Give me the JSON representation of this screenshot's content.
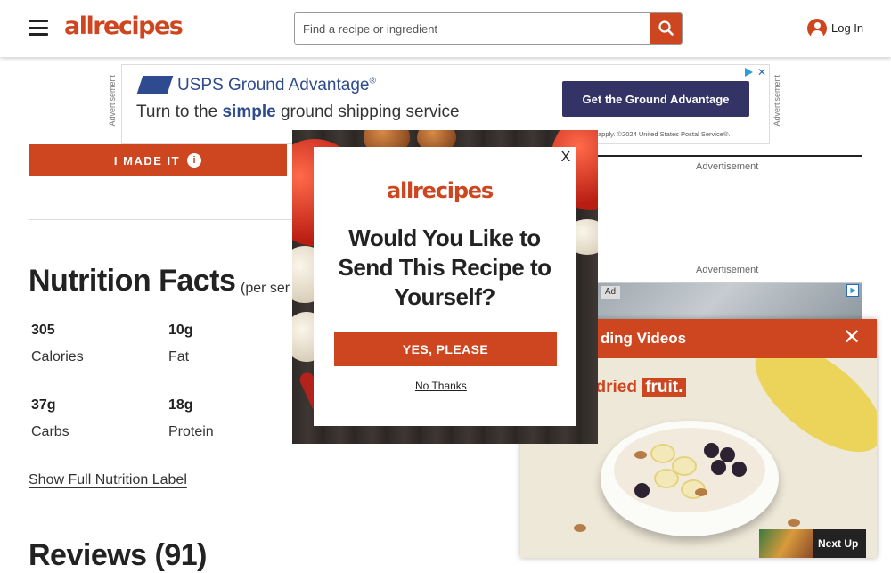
{
  "header": {
    "logo_text": "allrecipes",
    "search_placeholder": "Find a recipe or ingredient",
    "login_label": "Log In"
  },
  "top_ad": {
    "side_label": "Advertisement",
    "brand": "USPS Ground Advantage",
    "brand_mark": "®",
    "headline_pre": "Turn to the ",
    "headline_bold": "simple",
    "headline_post": " ground shipping service",
    "cta": "Get the Ground Advantage",
    "fine_print": "apply. ©2024 United States Postal Service®."
  },
  "recipe": {
    "made_it_label": "I MADE IT",
    "nutrition_title": "Nutrition Facts",
    "nutrition_subtitle": "(per ser",
    "nutrients": [
      {
        "value": "305",
        "label": "Calories"
      },
      {
        "value": "10g",
        "label": "Fat"
      },
      {
        "value": "37g",
        "label": "Carbs"
      },
      {
        "value": "18g",
        "label": "Protein"
      }
    ],
    "full_label_link": "Show Full Nutrition Label",
    "reviews_title": "Reviews (91)"
  },
  "right_rail": {
    "ad_label_1": "Advertisement",
    "ad_label_2": "Advertisement",
    "ad_tag": "Ad"
  },
  "video_player": {
    "title": "ding Videos",
    "caption_pre": "resh and dried ",
    "caption_highlight": "fruit.",
    "next_up_label": "Next Up"
  },
  "modal": {
    "close_label": "X",
    "logo_text": "allrecipes",
    "question": "Would You Like to Send This Recipe to Yourself?",
    "yes_label": "YES, PLEASE",
    "no_label": "No Thanks"
  },
  "colors": {
    "brand": "#ce4620",
    "usps_blue": "#2d4b8e",
    "usps_cta": "#333366"
  },
  "icons": [
    "menu-icon",
    "search-icon",
    "user-icon",
    "info-icon",
    "close-icon",
    "adchoices-icon"
  ]
}
